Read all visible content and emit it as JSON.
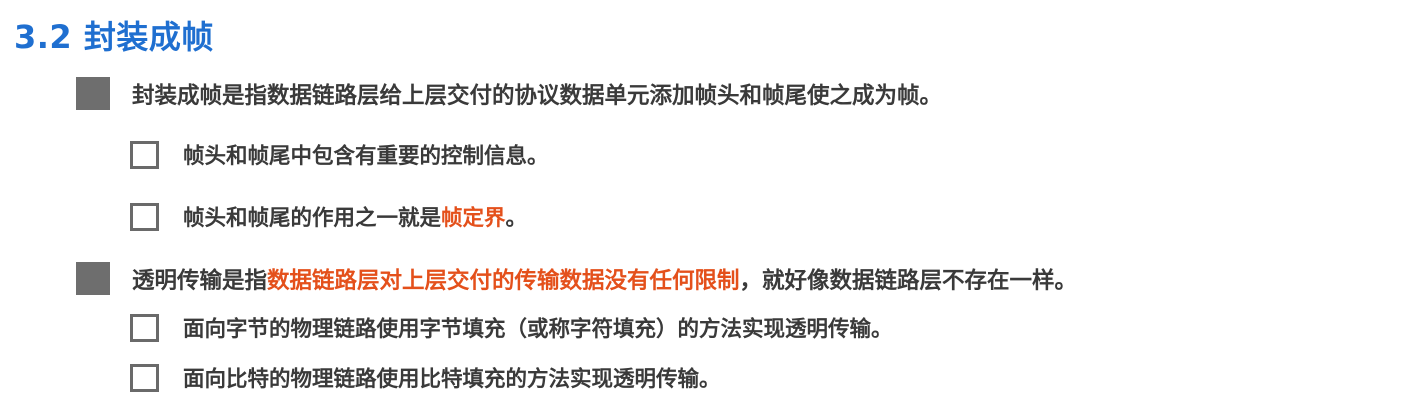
{
  "section": {
    "title": "3.2 封装成帧"
  },
  "items": [
    {
      "level": 1,
      "marker": "filled-square",
      "text": "封装成帧是指数据链路层给上层交付的协议数据单元添加帧头和帧尾使之成为帧。"
    },
    {
      "level": 2,
      "marker": "empty-square",
      "text": "帧头和帧尾中包含有重要的控制信息。"
    },
    {
      "level": 2,
      "marker": "empty-square",
      "text_before": "帧头和帧尾的作用之一就是",
      "highlight": "帧定界",
      "text_after": "。"
    },
    {
      "level": 1,
      "marker": "filled-square",
      "text_before": "透明传输是指",
      "highlight": "数据链路层对上层交付的传输数据没有任何限制",
      "text_after": "，就好像数据链路层不存在一样。"
    },
    {
      "level": 2,
      "marker": "empty-square",
      "text": "面向字节的物理链路使用字节填充（或称字符填充）的方法实现透明传输。"
    },
    {
      "level": 2,
      "marker": "empty-square",
      "text": "面向比特的物理链路使用比特填充的方法实现透明传输。"
    }
  ],
  "colors": {
    "title": "#1f6fd0",
    "body_text": "#3a3a3a",
    "highlight": "#e4501b",
    "marker": "#6e6e6e"
  }
}
